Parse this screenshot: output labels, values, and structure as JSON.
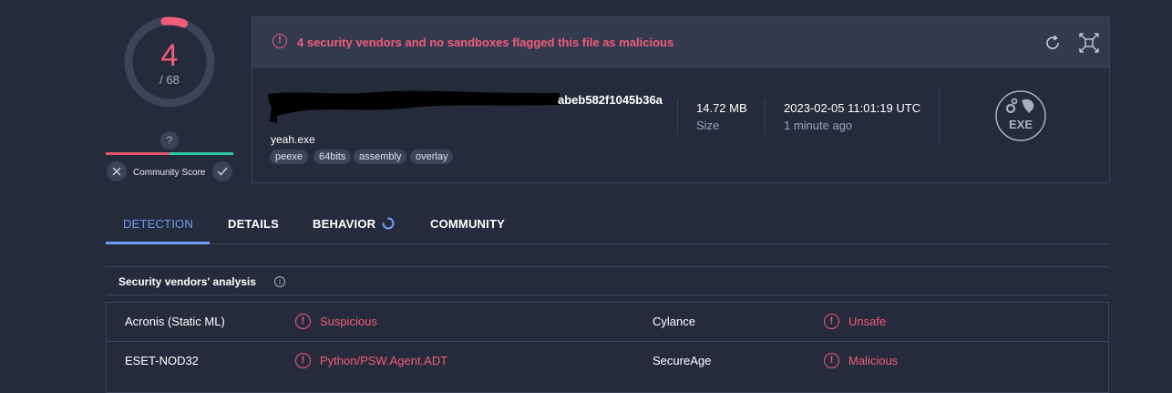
{
  "score": {
    "detections": "4",
    "total": "/ 68",
    "accent": "#f25c7a",
    "fraction": 0.0588
  },
  "community": {
    "question": "?",
    "label": "Community Score",
    "dismiss_icon": "close-icon",
    "confirm_icon": "check-icon"
  },
  "alert": {
    "text": "4 security vendors and no sandboxes flagged this file as malicious",
    "icon": "alert-circle-icon"
  },
  "file": {
    "hash_visible": "abeb582f1045b36a",
    "name": "yeah.exe",
    "tags": [
      "peexe",
      "64bits",
      "assembly",
      "overlay"
    ],
    "size_value": "14.72 MB",
    "size_label": "Size",
    "date_value": "2023-02-05 11:01:19 UTC",
    "date_ago": "1 minute ago",
    "type_icon_label": "EXE"
  },
  "tabs": [
    "DETECTION",
    "DETAILS",
    "BEHAVIOR",
    "COMMUNITY"
  ],
  "analysis": {
    "title": "Security vendors' analysis",
    "rows": [
      {
        "vendor_a": "Acronis (Static ML)",
        "verdict_a": "Suspicious",
        "vendor_b": "Cylance",
        "verdict_b": "Unsafe"
      },
      {
        "vendor_a": "ESET-NOD32",
        "verdict_a": "Python/PSW.Agent.ADT",
        "vendor_b": "SecureAge",
        "verdict_b": "Malicious"
      }
    ]
  }
}
